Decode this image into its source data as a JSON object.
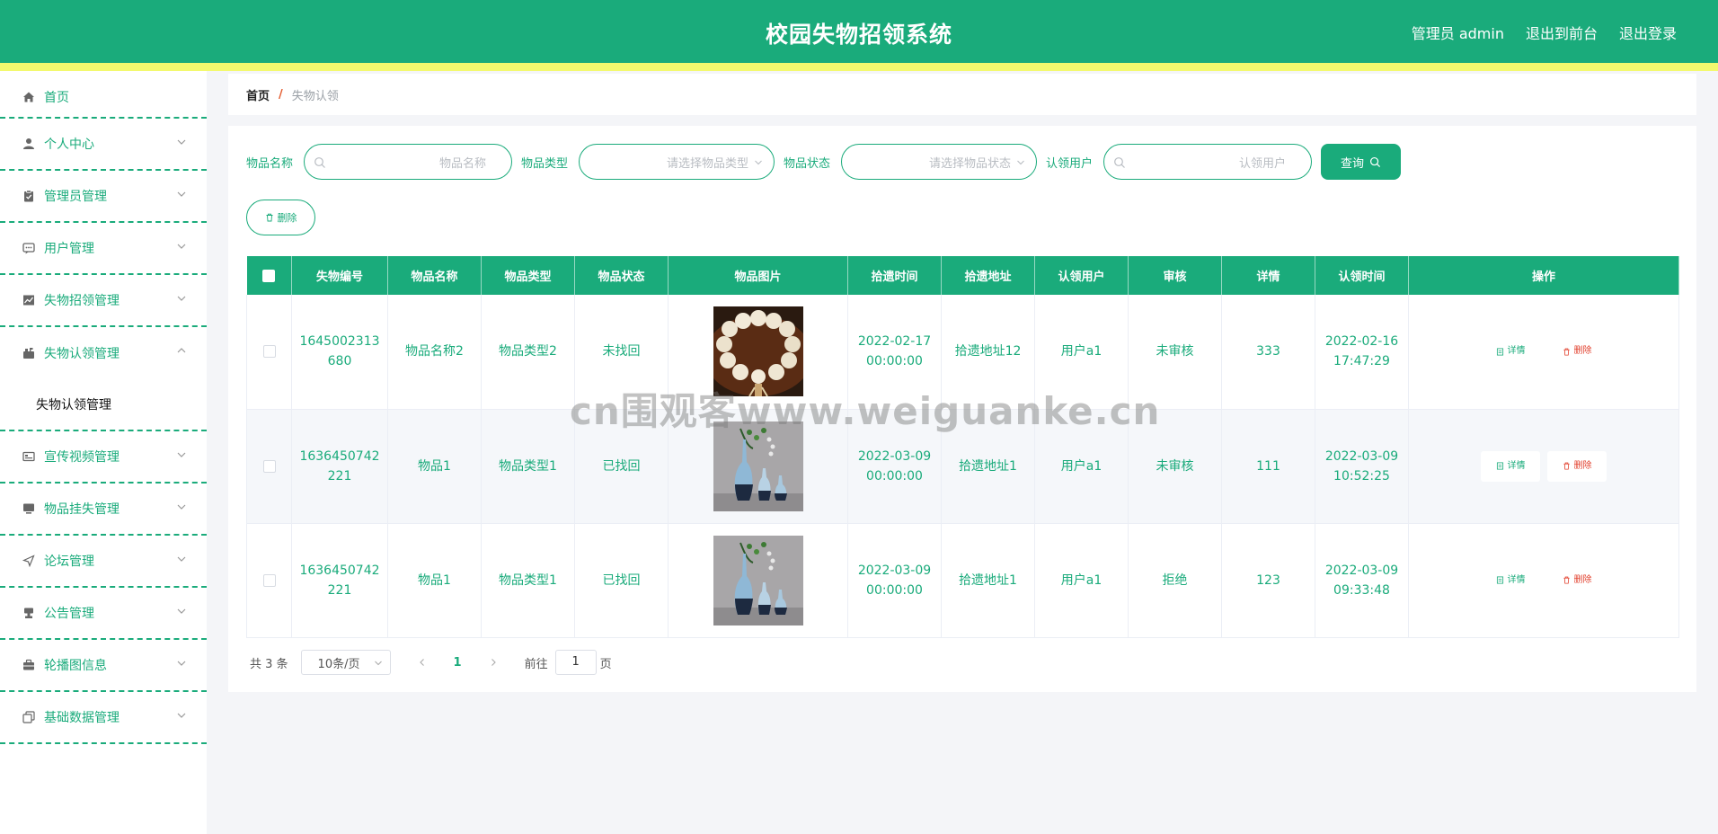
{
  "header": {
    "title": "校园失物招领系统",
    "admin_label": "管理员 admin",
    "to_front_label": "退出到前台",
    "logout_label": "退出登录"
  },
  "sidebar": {
    "items": [
      {
        "label": "首页",
        "icon": "home-icon"
      },
      {
        "label": "个人中心",
        "icon": "user-icon"
      },
      {
        "label": "管理员管理",
        "icon": "clipboard-icon"
      },
      {
        "label": "用户管理",
        "icon": "chat-icon"
      },
      {
        "label": "失物招领管理",
        "icon": "chart-icon"
      },
      {
        "label": "失物认领管理",
        "icon": "mailbox-icon",
        "sub": "失物认领管理"
      },
      {
        "label": "宣传视频管理",
        "icon": "card-icon"
      },
      {
        "label": "物品挂失管理",
        "icon": "monitor-icon"
      },
      {
        "label": "论坛管理",
        "icon": "send-icon"
      },
      {
        "label": "公告管理",
        "icon": "stamp-icon"
      },
      {
        "label": "轮播图信息",
        "icon": "briefcase-icon"
      },
      {
        "label": "基础数据管理",
        "icon": "copy-icon"
      }
    ]
  },
  "breadcrumb": {
    "home": "首页",
    "sep": "/",
    "current": "失物认领"
  },
  "filters": {
    "name_label": "物品名称",
    "name_placeholder": "物品名称",
    "type_label": "物品类型",
    "type_placeholder": "请选择物品类型",
    "status_label": "物品状态",
    "status_placeholder": "请选择物品状态",
    "user_label": "认领用户",
    "user_placeholder": "认领用户",
    "query_label": "查询"
  },
  "delete_label": "删除",
  "table": {
    "columns": [
      "失物编号",
      "物品名称",
      "物品类型",
      "物品状态",
      "物品图片",
      "拾遗时间",
      "拾遗地址",
      "认领用户",
      "审核",
      "详情",
      "认领时间",
      "操作"
    ],
    "rows": [
      {
        "id_a": "1645002313",
        "id_b": "680",
        "name": "物品名称2",
        "type": "物品类型2",
        "status": "未找回",
        "image": "beads",
        "time_a": "2022-02-17",
        "time_b": "00:00:00",
        "address": "拾遗地址12",
        "user": "用户a1",
        "review": "未审核",
        "detail": "333",
        "claim_a": "2022-02-16",
        "claim_b": "17:47:29"
      },
      {
        "id_a": "1636450742",
        "id_b": "221",
        "name": "物品1",
        "type": "物品类型1",
        "status": "已找回",
        "image": "vases",
        "time_a": "2022-03-09",
        "time_b": "00:00:00",
        "address": "拾遗地址1",
        "user": "用户a1",
        "review": "未审核",
        "detail": "111",
        "claim_a": "2022-03-09",
        "claim_b": "10:52:25"
      },
      {
        "id_a": "1636450742",
        "id_b": "221",
        "name": "物品1",
        "type": "物品类型1",
        "status": "已找回",
        "image": "vases",
        "time_a": "2022-03-09",
        "time_b": "00:00:00",
        "address": "拾遗地址1",
        "user": "用户a1",
        "review": "拒绝",
        "detail": "123",
        "claim_a": "2022-03-09",
        "claim_b": "09:33:48"
      }
    ],
    "op_detail": "详情",
    "op_delete": "删除"
  },
  "pager": {
    "total": "共 3 条",
    "size": "10条/页",
    "page": "1",
    "goto": "前往",
    "jump": "1",
    "page_unit": "页"
  },
  "watermark": "cn围观客www.weiguanke.cn",
  "colors": {
    "brand": "#1aab7b",
    "stripe": "#f3f96e",
    "danger": "#e2402d"
  }
}
